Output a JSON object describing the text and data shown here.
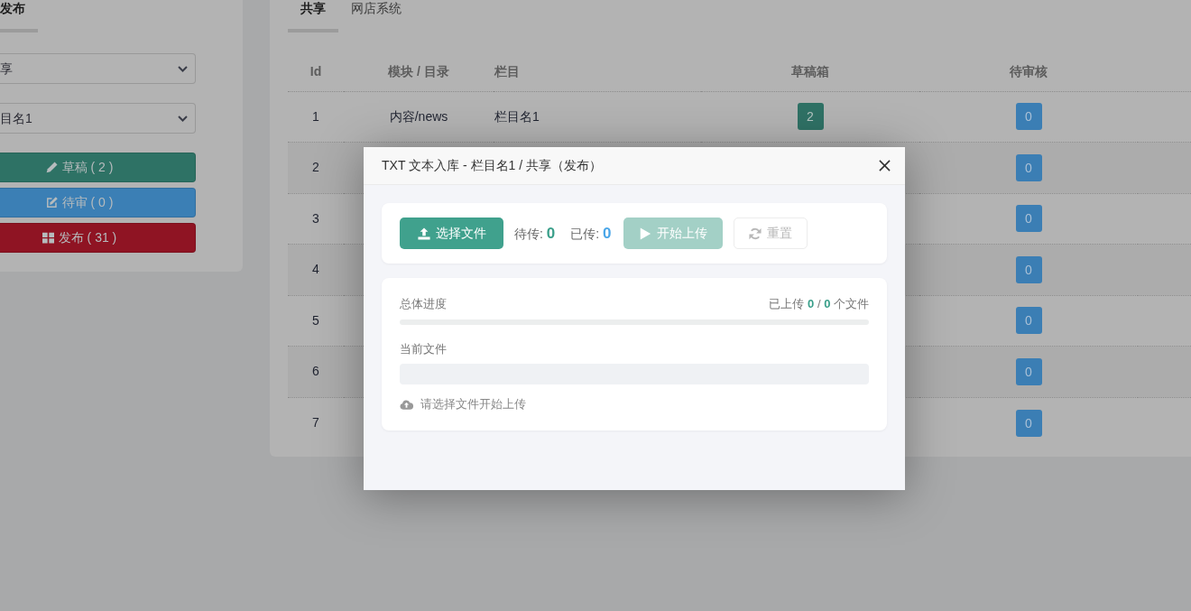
{
  "left_panel": {
    "tabs": [
      {
        "label": "发布",
        "selected": true
      }
    ],
    "selects": [
      {
        "value": "享"
      },
      {
        "value": "目名1"
      }
    ],
    "buttons": [
      {
        "kind": "draft",
        "label": "草稿 ( 2 )"
      },
      {
        "kind": "pending",
        "label": "待审 ( 0 )"
      },
      {
        "kind": "published",
        "label": "发布 ( 31 )"
      }
    ]
  },
  "main_panel": {
    "tabs": [
      {
        "label": "共享",
        "selected": true
      },
      {
        "label": "网店系统",
        "selected": false
      }
    ],
    "table": {
      "columns": [
        {
          "label": "Id",
          "kind": "id"
        },
        {
          "label": "模块 / 目录",
          "kind": "module"
        },
        {
          "label": "栏目",
          "kind": "column"
        },
        {
          "label": "草稿箱",
          "kind": "drafts"
        },
        {
          "label": "待审核",
          "kind": "pending"
        }
      ],
      "rows": [
        {
          "id": "1",
          "module": "内容/news",
          "column": "栏目名1",
          "drafts": "2",
          "pending": "0"
        },
        {
          "id": "2",
          "pending": "0"
        },
        {
          "id": "3",
          "pending": "0"
        },
        {
          "id": "4",
          "pending": "0"
        },
        {
          "id": "5",
          "pending": "0"
        },
        {
          "id": "6",
          "pending": "0"
        },
        {
          "id": "7",
          "pending": "0"
        }
      ]
    }
  },
  "modal": {
    "title": "TXT 文本入库 - 栏目名1 / 共享（发布）",
    "toolbar": {
      "choose_button": {
        "label": "选择文件"
      },
      "queued": "待传: **0**",
      "uploaded": "已传: **0**",
      "start_button": {
        "label": "开始上传",
        "disabled": true
      },
      "reset_button": {
        "label": "重置",
        "disabled": true
      }
    },
    "progress": {
      "label": "总体进度",
      "summary": "已上传 **0** / **0** 个文件",
      "level": 0
    },
    "current_file": {
      "label": "当前文件"
    },
    "hint": "请选择文件开始上传"
  }
}
